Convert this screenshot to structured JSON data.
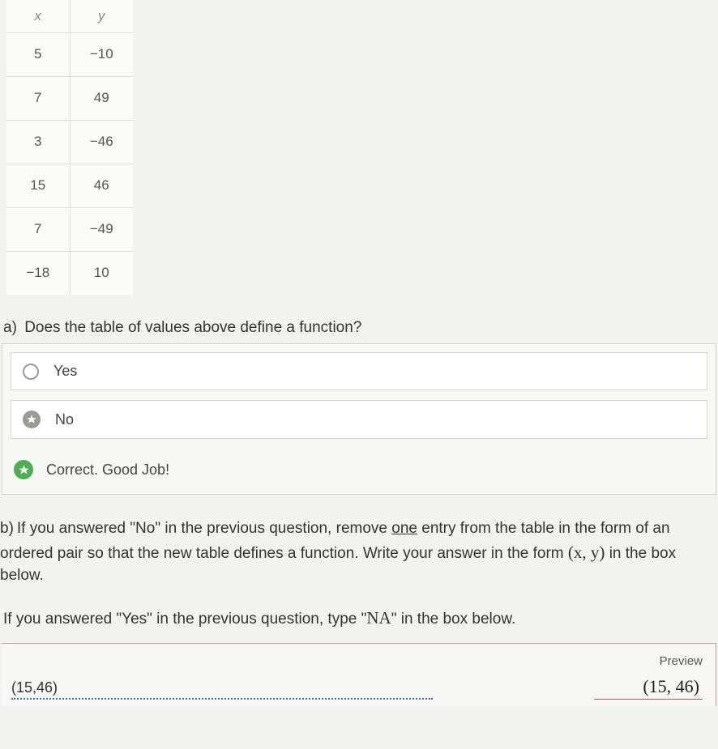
{
  "table": {
    "headers": {
      "x": "x",
      "y": "y"
    },
    "rows": [
      {
        "x": "5",
        "y": "−10"
      },
      {
        "x": "7",
        "y": "49"
      },
      {
        "x": "3",
        "y": "−46"
      },
      {
        "x": "15",
        "y": "46"
      },
      {
        "x": "7",
        "y": "−49"
      },
      {
        "x": "−18",
        "y": "10"
      }
    ]
  },
  "qa": {
    "part": "a)",
    "text": "Does the table of values above define a function?",
    "options": {
      "yes": "Yes",
      "no": "No"
    },
    "feedback": "Correct. Good Job!"
  },
  "qb": {
    "part": "b)",
    "text1": "If you answered \"No\" in the previous question, remove ",
    "underlined": "one",
    "text2": " entry from the table in the form of an ordered pair so that the new table defines a function.  Write your answer in the form ",
    "pair": "(x, y)",
    "text3": " in the box below."
  },
  "intermediate": {
    "text1": "If you answered \"Yes\" in the previous question, type \"",
    "na": "NA",
    "text2": "\" in the box below."
  },
  "answer": {
    "input": "(15,46)",
    "preview_label": "Preview",
    "preview_value": "(15, 46)"
  }
}
